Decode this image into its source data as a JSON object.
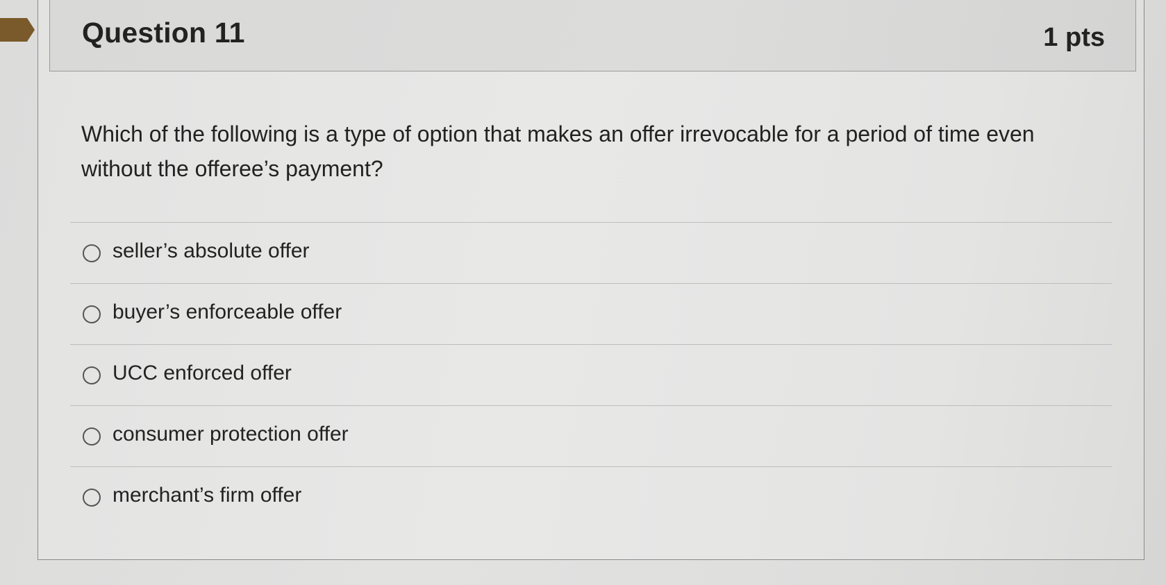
{
  "question": {
    "title": "Question 11",
    "points": "1 pts",
    "text": "Which of the following is a type of option that makes an offer irrevocable for a period of time even without the offeree’s payment?"
  },
  "answers": [
    {
      "label": "seller’s absolute offer",
      "selected": false
    },
    {
      "label": "buyer’s enforceable offer",
      "selected": false
    },
    {
      "label": "UCC enforced offer",
      "selected": false
    },
    {
      "label": "consumer protection offer",
      "selected": false
    },
    {
      "label": "merchant’s firm offer",
      "selected": false
    }
  ],
  "colors": {
    "flag": "#7a5a2a",
    "text": "#222222",
    "border": "#8a8a8a"
  },
  "icons": {
    "question_marker": "bookmark-flag-icon",
    "choice": "radio-button-icon"
  }
}
